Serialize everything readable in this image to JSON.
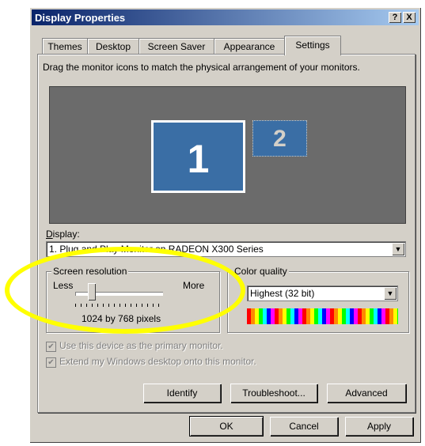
{
  "window": {
    "title": "Display Properties",
    "help_btn": "?",
    "close_btn": "X"
  },
  "tabs": [
    {
      "label": "Themes"
    },
    {
      "label": "Desktop"
    },
    {
      "label": "Screen Saver"
    },
    {
      "label": "Appearance"
    },
    {
      "label": "Settings",
      "active": true
    }
  ],
  "settings": {
    "instructions": "Drag the monitor icons to match the physical arrangement of your monitors.",
    "monitor1": "1",
    "monitor2": "2",
    "display_label": "Display:",
    "display_value": "1. Plug and Play Monitor on RADEON X300 Series",
    "resolution": {
      "title": "Screen resolution",
      "less": "Less",
      "more": "More",
      "value": "1024 by 768 pixels"
    },
    "color": {
      "title": "Color quality",
      "value": "Highest (32 bit)"
    },
    "primary_checkbox": "Use this device as the primary monitor.",
    "extend_checkbox": "Extend my Windows desktop onto this monitor.",
    "identify": "Identify",
    "troubleshoot": "Troubleshoot...",
    "advanced": "Advanced"
  },
  "buttons": {
    "ok": "OK",
    "cancel": "Cancel",
    "apply": "Apply"
  },
  "colors": {
    "titlebar_start": "#0a246a",
    "face": "#d4d0c8",
    "monitor_blue": "#3a6ea5",
    "highlight_ellipse": "#ffff00"
  }
}
